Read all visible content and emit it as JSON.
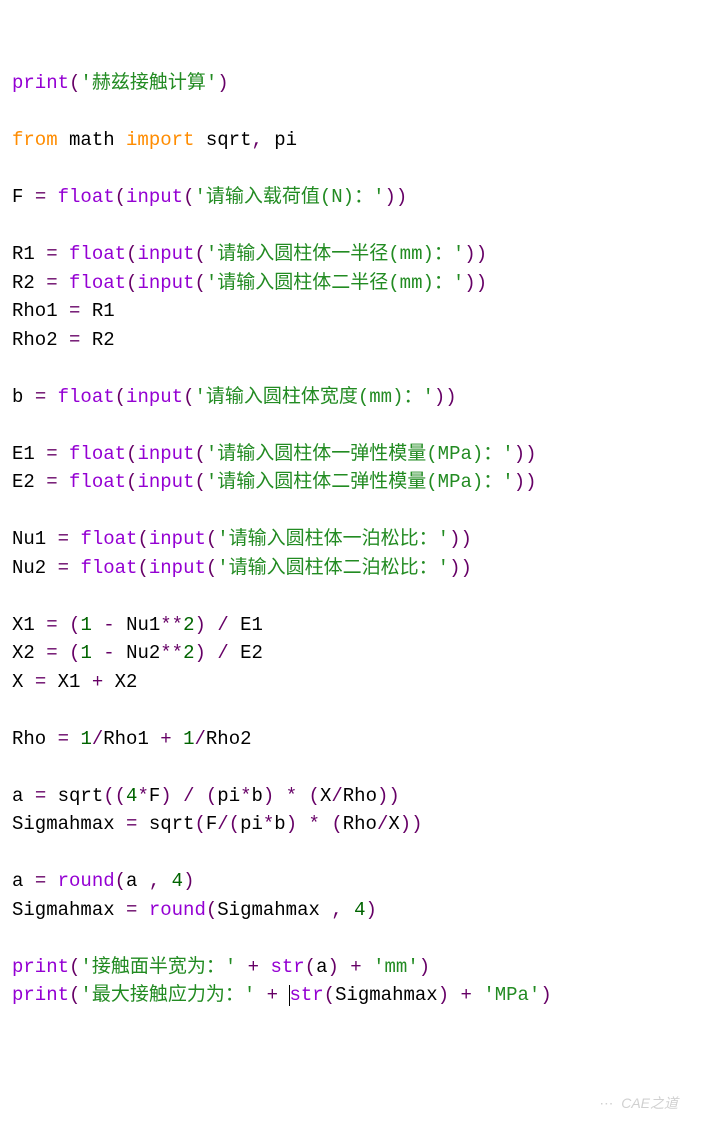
{
  "c": {
    "print": "print",
    "from": "from",
    "import": "import",
    "math": "math",
    "sqrt": "sqrt",
    "pi": "pi",
    "float": "float",
    "input": "input",
    "str": "str",
    "round": "round",
    "F": "F",
    "R1": "R1",
    "R2": "R2",
    "Rho1": "Rho1",
    "Rho2": "Rho2",
    "b": "b",
    "E1": "E1",
    "E2": "E2",
    "Nu1": "Nu1",
    "Nu2": "Nu2",
    "X1": "X1",
    "X2": "X2",
    "X": "X",
    "Rho": "Rho",
    "a": "a",
    "Sigmahmax": "Sigmahmax",
    "one": "1",
    "two": "2",
    "four": "4",
    "dec4": "4",
    "eq": "=",
    "plus": "+",
    "minus": "-",
    "slash": "/",
    "star": "*",
    "dstar": "**",
    "lp": "(",
    "rp": ")",
    "comma": ",",
    "sp": " "
  },
  "s": {
    "title": "'赫兹接触计算'",
    "loadPrompt": "'请输入载荷值(N)：'",
    "r1Prompt": "'请输入圆柱体一半径(mm)：'",
    "r2Prompt": "'请输入圆柱体二半径(mm)：'",
    "bPrompt": "'请输入圆柱体宽度(mm)：'",
    "e1Prompt": "'请输入圆柱体一弹性模量(MPa)：'",
    "e2Prompt": "'请输入圆柱体二弹性模量(MPa)：'",
    "nu1Prompt": "'请输入圆柱体一泊松比：'",
    "nu2Prompt": "'请输入圆柱体二泊松比：'",
    "out1a": "'接触面半宽为：'",
    "out1b": "'mm'",
    "out2a": "'最大接触应力为：'",
    "out2b": "'MPa'"
  },
  "watermark": "CAE之道"
}
